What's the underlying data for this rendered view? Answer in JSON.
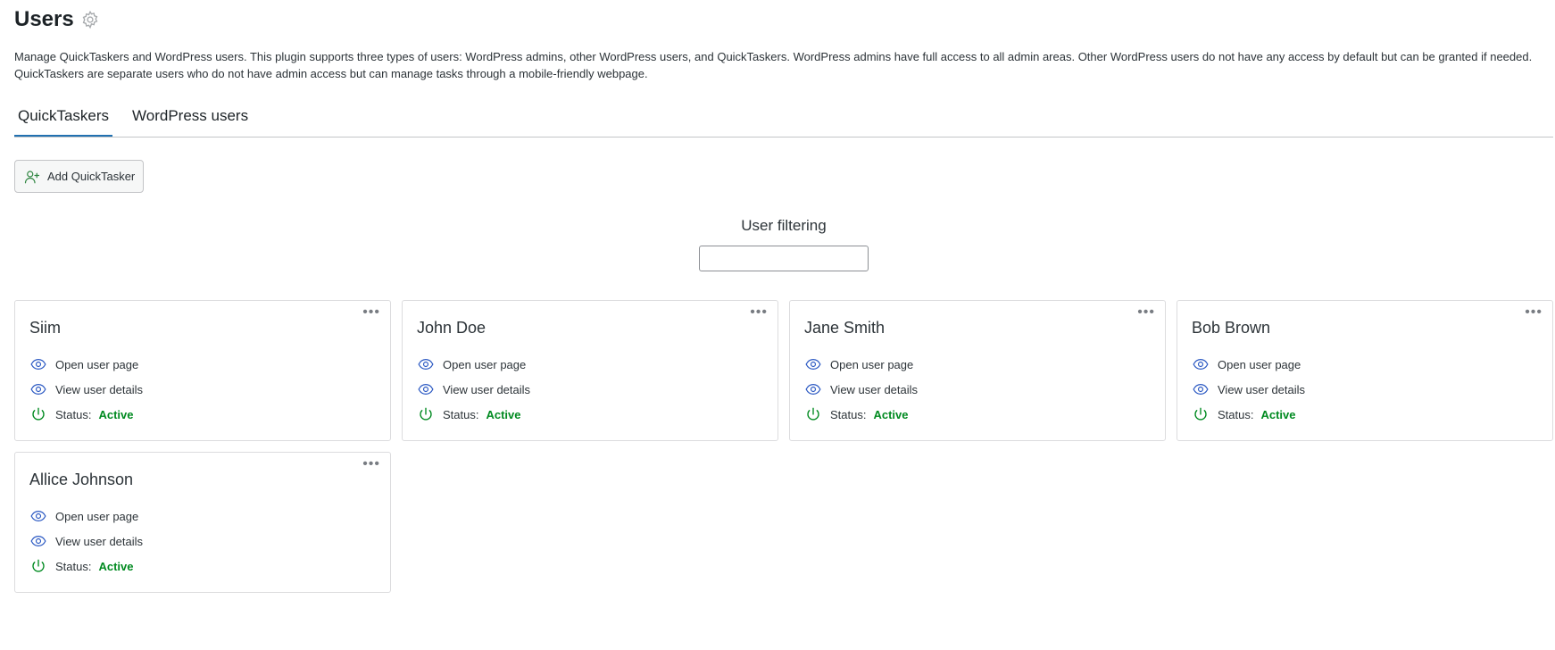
{
  "page": {
    "title": "Users",
    "description": "Manage QuickTaskers and WordPress users. This plugin supports three types of users: WordPress admins, other WordPress users, and QuickTaskers. WordPress admins have full access to all admin areas. Other WordPress users do not have any access by default but can be granted if needed. QuickTaskers are separate users who do not have admin access but can manage tasks through a mobile-friendly webpage."
  },
  "tabs": [
    {
      "label": "QuickTaskers",
      "active": true
    },
    {
      "label": "WordPress users",
      "active": false
    }
  ],
  "toolbar": {
    "add_label": "Add QuickTasker"
  },
  "filter": {
    "title": "User filtering",
    "value": "",
    "placeholder": ""
  },
  "cards": [
    {
      "name": "Siim",
      "open_label": "Open user page",
      "details_label": "View user details",
      "status_label": "Status:",
      "status_value": "Active"
    },
    {
      "name": "John Doe",
      "open_label": "Open user page",
      "details_label": "View user details",
      "status_label": "Status:",
      "status_value": "Active"
    },
    {
      "name": "Jane Smith",
      "open_label": "Open user page",
      "details_label": "View user details",
      "status_label": "Status:",
      "status_value": "Active"
    },
    {
      "name": "Bob Brown",
      "open_label": "Open user page",
      "details_label": "View user details",
      "status_label": "Status:",
      "status_value": "Active"
    },
    {
      "name": "Allice Johnson",
      "open_label": "Open user page",
      "details_label": "View user details",
      "status_label": "Status:",
      "status_value": "Active"
    }
  ],
  "colors": {
    "accent": "#2271b1",
    "icon_blue": "#2b59c3",
    "status_green": "#008a20",
    "add_user_icon": "#2e8540"
  },
  "icons": {
    "settings": "gear-icon",
    "add_user": "user-plus-icon",
    "open_page": "eye-icon",
    "view_details": "eye-icon",
    "status": "power-icon",
    "card_menu": "more-dots-icon"
  }
}
